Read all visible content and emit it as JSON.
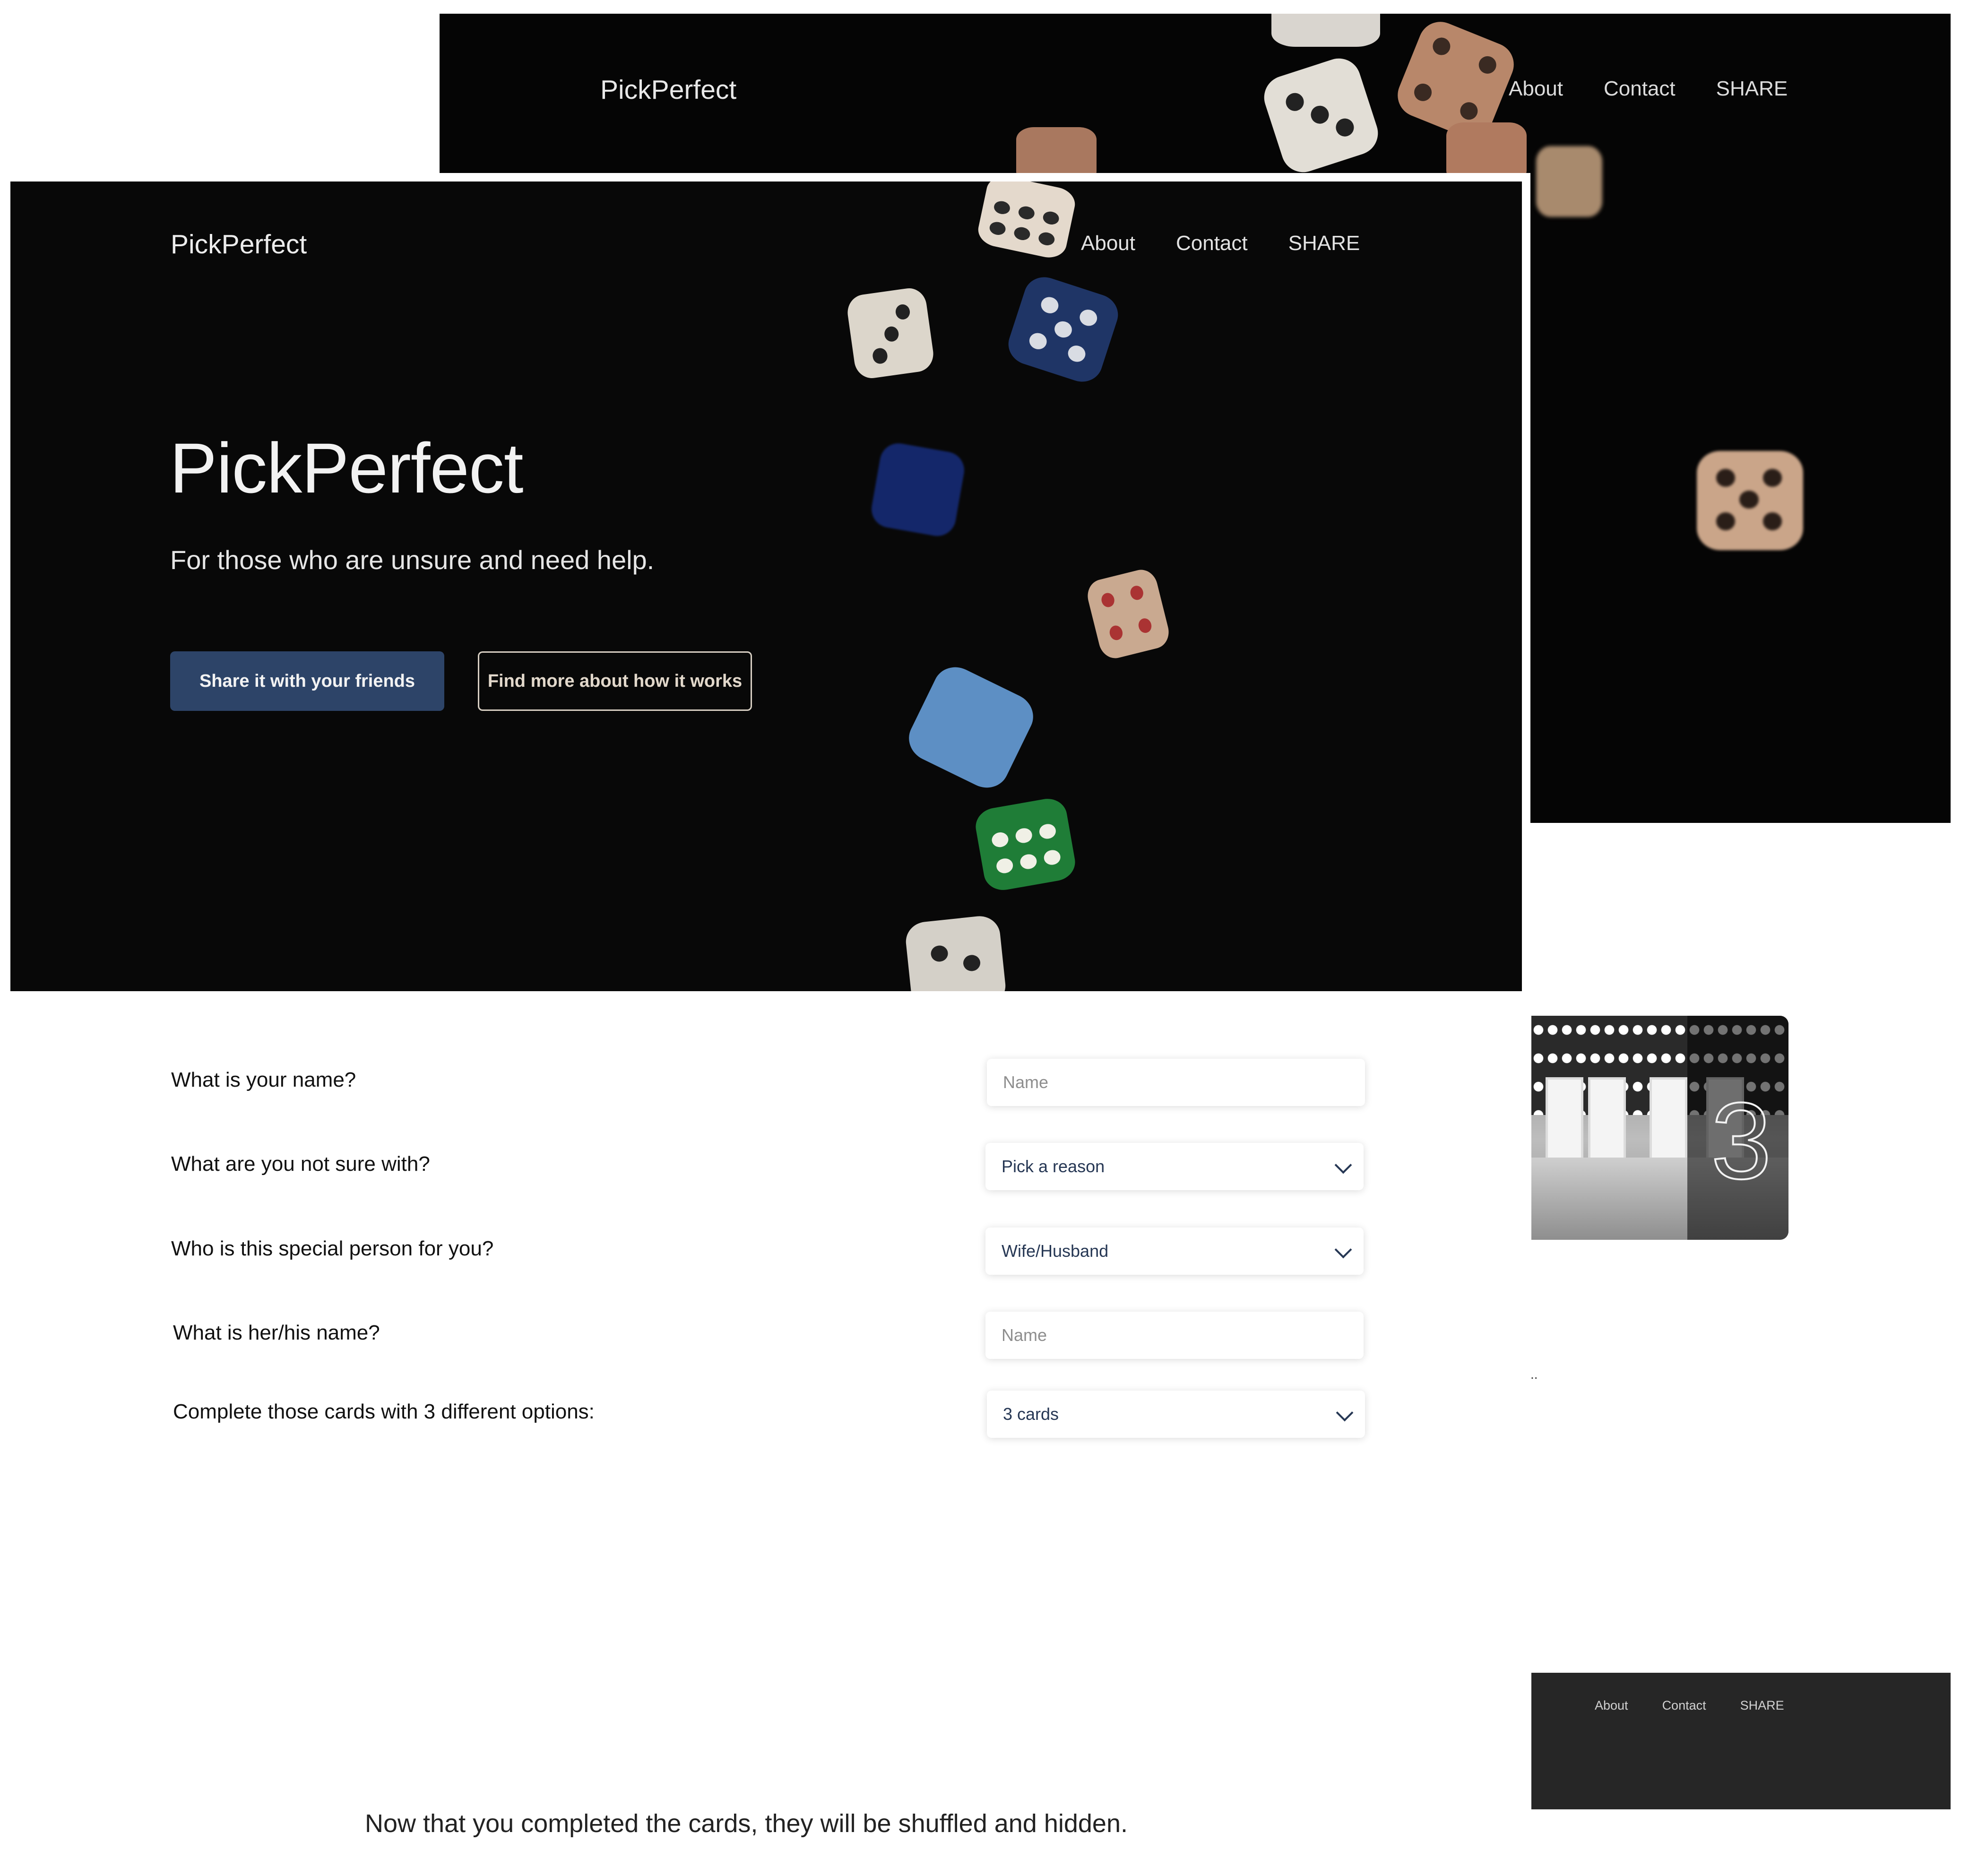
{
  "back_screen": {
    "brand": "PickPerfect",
    "nav": [
      "About",
      "Contact",
      "SHARE"
    ]
  },
  "hero": {
    "brand": "PickPerfect",
    "nav": [
      "About",
      "Contact",
      "SHARE"
    ],
    "title": "PickPerfect",
    "subtitle": "For those who are unsure and need help.",
    "primary_button": "Share it with your friends",
    "secondary_button": "Find more about how it works",
    "colors": {
      "primary_button": "#2d4468",
      "secondary_border": "#d8cfc3",
      "background": "#080808"
    }
  },
  "form": {
    "rows": [
      {
        "question": "What is your name?",
        "type": "input",
        "placeholder": "Name"
      },
      {
        "question": "What are you not sure with?",
        "type": "select",
        "value": "Pick a reason"
      },
      {
        "question": "Who is this special person for you?",
        "type": "select",
        "value": "Wife/Husband"
      },
      {
        "question": "What is her/his name?",
        "type": "input",
        "placeholder": "Name"
      },
      {
        "question": "Complete those cards with 3 different options:",
        "type": "select",
        "value": "3 cards"
      }
    ]
  },
  "door_card": {
    "number": "3"
  },
  "stray_mark": "..",
  "footer": {
    "nav": [
      "About",
      "Contact",
      "SHARE"
    ]
  },
  "note": "Now that you completed the cards, they will be shuffled and hidden."
}
